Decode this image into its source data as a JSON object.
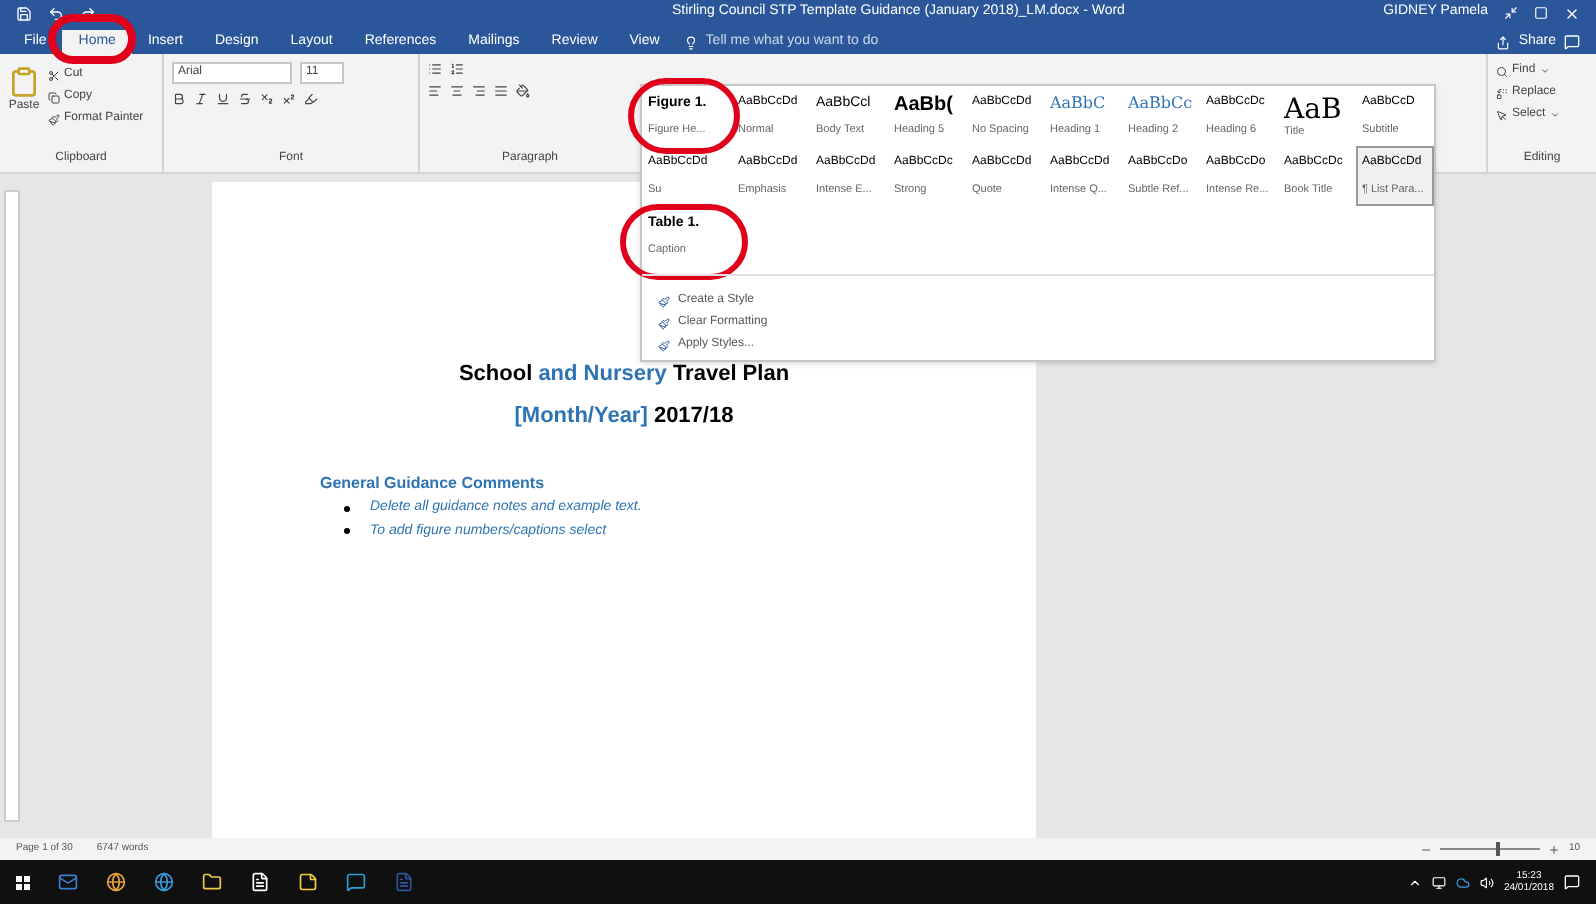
{
  "window": {
    "title": "Stirling Council STP Template Guidance (January 2018)_LM.docx  -  Word",
    "user": "GIDNEY Pamela"
  },
  "tabs": [
    {
      "label": "File",
      "selected": false
    },
    {
      "label": "Home",
      "selected": true
    },
    {
      "label": "Insert",
      "selected": false
    },
    {
      "label": "Design",
      "selected": false
    },
    {
      "label": "Layout",
      "selected": false
    },
    {
      "label": "References",
      "selected": false
    },
    {
      "label": "Mailings",
      "selected": false
    },
    {
      "label": "Review",
      "selected": false
    },
    {
      "label": "View",
      "selected": false
    }
  ],
  "tell_me": {
    "placeholder": "Tell me what you want to do"
  },
  "share": "Share",
  "clipboard": {
    "paste": "Paste",
    "cut": "Cut",
    "copy": "Copy",
    "format_painter": "Format Painter",
    "label": "Clipboard"
  },
  "font": {
    "name": "Arial",
    "size": "11",
    "label": "Font"
  },
  "paragraph": {
    "label": "Paragraph"
  },
  "styles_rows": [
    [
      {
        "preview": "Figure 1.",
        "label": "Figure He...",
        "selected": false
      },
      {
        "preview": "AaBbCcDd",
        "label": "Normal",
        "selected": false
      },
      {
        "preview": "AaBbCcl",
        "label": "Body Text",
        "selected": false
      },
      {
        "preview": "AaBb(",
        "label": "Heading 5",
        "selected": false
      },
      {
        "preview": "AaBbCcDd",
        "label": "No Spacing",
        "selected": false
      },
      {
        "preview": "AaBbC",
        "label": "Heading 1",
        "selected": false
      },
      {
        "preview": "AaBbCc",
        "label": "Heading 2",
        "selected": false
      },
      {
        "preview": "AaBbCcDc",
        "label": "Heading 6",
        "selected": false
      },
      {
        "preview": "AaB",
        "label": "Title",
        "selected": false
      },
      {
        "preview": "AaBbCcD",
        "label": "Subtitle",
        "selected": false
      }
    ],
    [
      {
        "preview": "AaBbCcDd",
        "label": "Su",
        "selected": false
      },
      {
        "preview": "AaBbCcDd",
        "label": "Emphasis",
        "selected": false
      },
      {
        "preview": "AaBbCcDd",
        "label": "Intense E...",
        "selected": false
      },
      {
        "preview": "AaBbCcDc",
        "label": "Strong",
        "selected": false
      },
      {
        "preview": "AaBbCcDd",
        "label": "Quote",
        "selected": false
      },
      {
        "preview": "AaBbCcDd",
        "label": "Intense Q...",
        "selected": false
      },
      {
        "preview": "AaBbCcDo",
        "label": "Subtle Ref...",
        "selected": false
      },
      {
        "preview": "AaBbCcDo",
        "label": "Intense Re...",
        "selected": false
      },
      {
        "preview": "AaBbCcDc",
        "label": "Book Title",
        "selected": false
      },
      {
        "preview": "AaBbCcDd",
        "label": "¶ List Para...",
        "selected": true
      }
    ],
    [
      {
        "preview": "Table 1.",
        "label": "Caption",
        "selected": false
      }
    ]
  ],
  "styles_menu": [
    "Create a Style",
    "Clear Formatting",
    "Apply Styles..."
  ],
  "editing": {
    "find": "Find",
    "replace": "Replace",
    "select": "Select",
    "label": "Editing"
  },
  "document": {
    "title": [
      {
        "text": "School ",
        "highlight": false
      },
      {
        "text": "and Nursery",
        "highlight": true
      },
      {
        "text": " Travel Plan",
        "highlight": false
      }
    ],
    "subtitle": [
      {
        "text": "[Month/Year]",
        "highlight": true
      },
      {
        "text": " 2017/18",
        "highlight": false
      }
    ],
    "heading": "General Guidance Comments",
    "bullets": [
      "Delete all guidance notes and example text.",
      "To add figure numbers/captions select"
    ]
  },
  "status_bar": {
    "page": "Page 1 of 30",
    "words": "6747 words",
    "zoom": "10",
    "level": 0.55
  },
  "taskbar": {
    "time": "15:23",
    "date": "24/01/2018"
  }
}
